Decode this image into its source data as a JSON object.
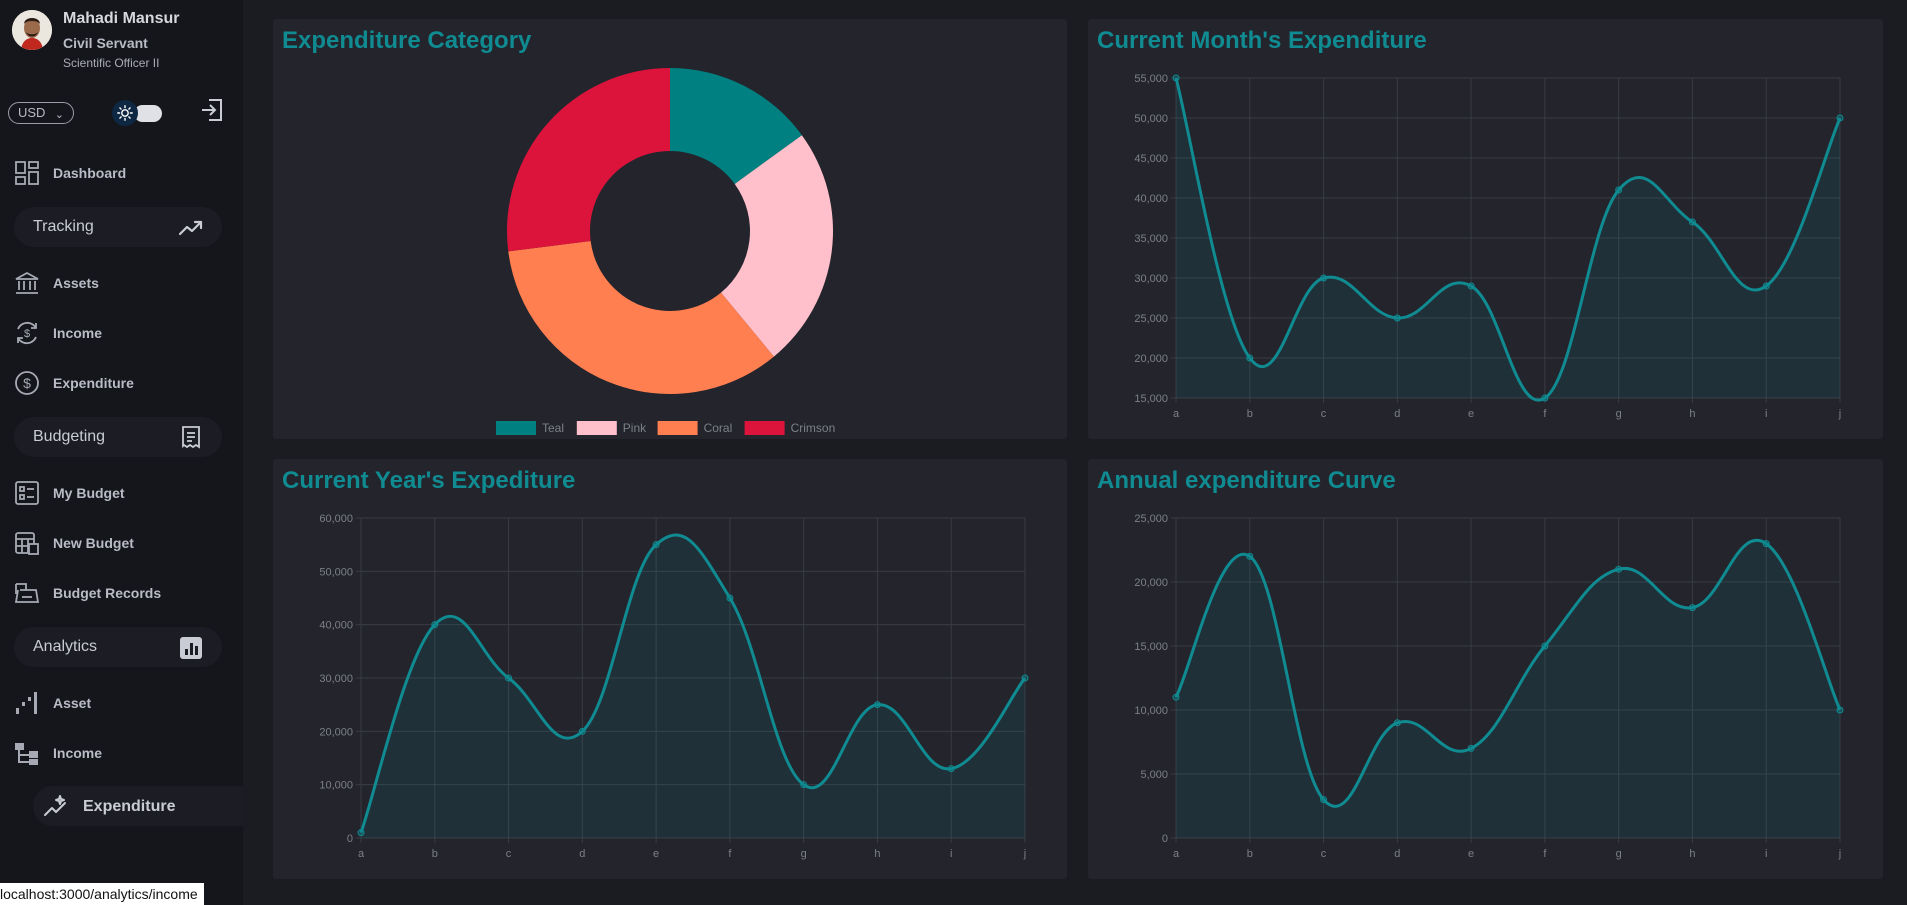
{
  "profile": {
    "name": "Mahadi Mansur",
    "role": "Civil Servant",
    "title": "Scientific Officer II",
    "avatar_icon": "avatar"
  },
  "controls": {
    "currency": "USD",
    "theme_icon": "sun-icon",
    "logout_icon": "logout-icon"
  },
  "nav": {
    "dashboard": "Dashboard",
    "tracking": "Tracking",
    "assets": "Assets",
    "income": "Income",
    "expenditure": "Expenditure",
    "budgeting": "Budgeting",
    "my_budget": "My Budget",
    "new_budget": "New Budget",
    "budget_records": "Budget Records",
    "analytics": "Analytics",
    "analytics_asset": "Asset",
    "analytics_income": "Income",
    "analytics_expenditure": "Expenditure"
  },
  "status_bar": {
    "url": "localhost:3000/analytics/income"
  },
  "colors": {
    "accent": "#0f8b91",
    "teal": "#008080",
    "pink": "#ffc0cb",
    "coral": "#ff7f50",
    "crimson": "#dc143c"
  },
  "chart_data": [
    {
      "type": "pie",
      "title": "Expenditure Category",
      "donut": true,
      "labels": [
        "Teal",
        "Pink",
        "Coral",
        "Crimson"
      ],
      "values": [
        15,
        24,
        34,
        27
      ],
      "colors": [
        "#008080",
        "#ffc0cb",
        "#ff7f50",
        "#dc143c"
      ],
      "legend": "bottom"
    },
    {
      "type": "area",
      "title": "Current Month's Expenditure",
      "categories": [
        "a",
        "b",
        "c",
        "d",
        "e",
        "f",
        "g",
        "h",
        "i",
        "j"
      ],
      "values": [
        55000,
        20000,
        30000,
        25000,
        29000,
        15000,
        41000,
        37000,
        29000,
        50000
      ],
      "ylim": [
        15000,
        55000
      ],
      "yticks": [
        "15,000",
        "20,000",
        "25,000",
        "30,000",
        "35,000",
        "40,000",
        "45,000",
        "50,000",
        "55,000"
      ],
      "grid": true
    },
    {
      "type": "area",
      "title": "Current Year's Expediture",
      "categories": [
        "a",
        "b",
        "c",
        "d",
        "e",
        "f",
        "g",
        "h",
        "i",
        "j"
      ],
      "values": [
        1000,
        40000,
        30000,
        20000,
        55000,
        45000,
        10000,
        25000,
        13000,
        30000
      ],
      "ylim": [
        0,
        60000
      ],
      "yticks": [
        "0",
        "10,000",
        "20,000",
        "30,000",
        "40,000",
        "50,000",
        "60,000"
      ],
      "grid": true
    },
    {
      "type": "area",
      "title": "Annual expenditure Curve",
      "categories": [
        "a",
        "b",
        "c",
        "d",
        "e",
        "f",
        "g",
        "h",
        "i",
        "j"
      ],
      "values": [
        11000,
        22000,
        3000,
        9000,
        7000,
        15000,
        21000,
        18000,
        23000,
        10000
      ],
      "ylim": [
        0,
        25000
      ],
      "yticks": [
        "0",
        "5,000",
        "10,000",
        "15,000",
        "20,000",
        "25,000"
      ],
      "grid": true
    }
  ]
}
